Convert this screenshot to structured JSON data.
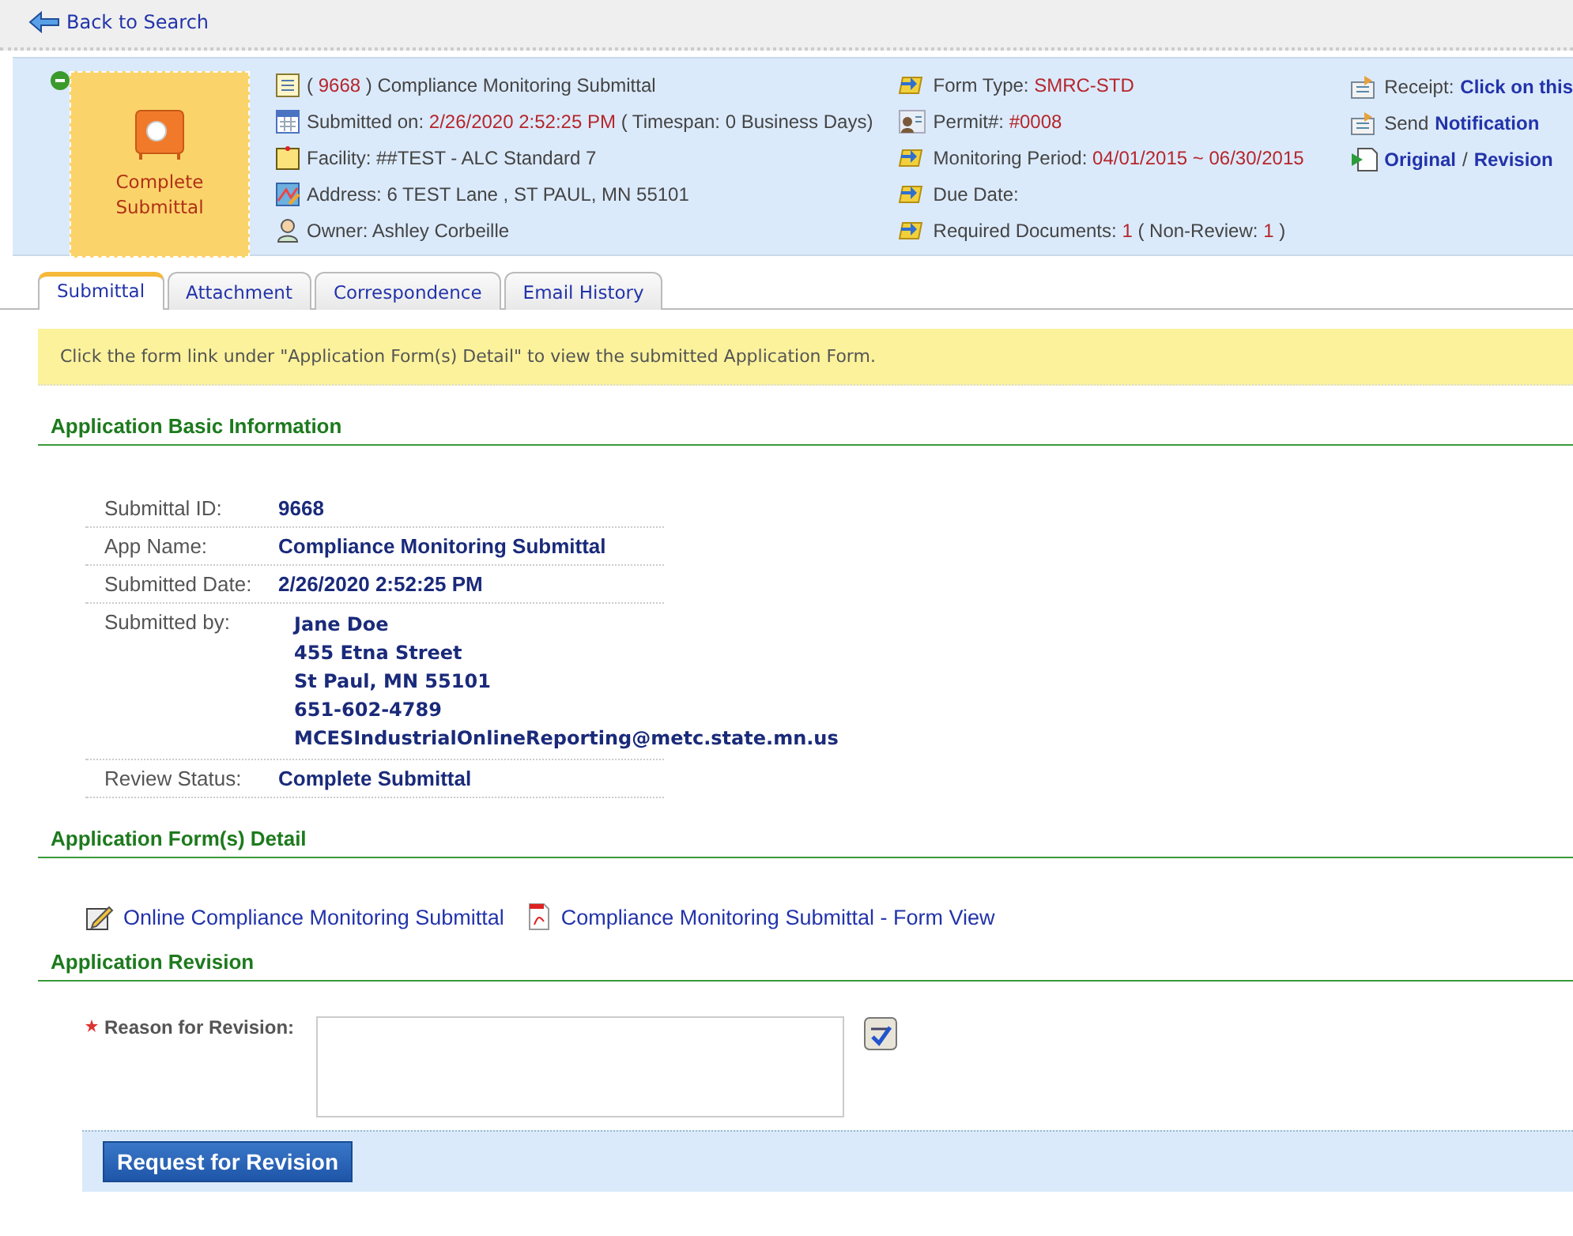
{
  "back_link": "Back to Search",
  "status_tile": {
    "label": "Complete Submittal",
    "expanded": true
  },
  "info_left": [
    {
      "parts": [
        {
          "kind": "plain",
          "text": "( "
        },
        {
          "kind": "value",
          "text": "9668"
        },
        {
          "kind": "plain",
          "text": " )  Compliance Monitoring Submittal"
        }
      ]
    },
    {
      "parts": [
        {
          "kind": "plain",
          "text": "Submitted on: "
        },
        {
          "kind": "value",
          "text": "2/26/2020 2:52:25 PM"
        },
        {
          "kind": "plain",
          "text": " ( Timespan: 0 Business Days)"
        }
      ]
    },
    {
      "parts": [
        {
          "kind": "plain",
          "text": "Facility: ##TEST - ALC Standard 7"
        }
      ]
    },
    {
      "parts": [
        {
          "kind": "plain",
          "text": "Address: 6 TEST Lane , ST PAUL, MN 55101"
        }
      ]
    },
    {
      "parts": [
        {
          "kind": "plain",
          "text": "Owner: Ashley Corbeille"
        }
      ]
    }
  ],
  "info_mid": [
    {
      "parts": [
        {
          "kind": "plain",
          "text": "Form Type: "
        },
        {
          "kind": "value",
          "text": "SMRC-STD"
        }
      ]
    },
    {
      "parts": [
        {
          "kind": "plain",
          "text": "Permit#: "
        },
        {
          "kind": "value",
          "text": "#0008"
        }
      ]
    },
    {
      "parts": [
        {
          "kind": "plain",
          "text": "Monitoring Period: "
        },
        {
          "kind": "value",
          "text": "04/01/2015 ~ 06/30/2015"
        }
      ]
    },
    {
      "parts": [
        {
          "kind": "plain",
          "text": "Due Date:"
        }
      ]
    },
    {
      "parts": [
        {
          "kind": "plain",
          "text": "Required Documents: "
        },
        {
          "kind": "value",
          "text": "1"
        },
        {
          "kind": "plain",
          "text": " ( Non-Review: "
        },
        {
          "kind": "value",
          "text": "1"
        },
        {
          "kind": "plain",
          "text": " )"
        }
      ]
    }
  ],
  "info_right": [
    {
      "parts": [
        {
          "kind": "plain",
          "text": "Receipt: "
        },
        {
          "kind": "link",
          "text": "Click on this"
        }
      ]
    },
    {
      "parts": [
        {
          "kind": "plain",
          "text": "Send "
        },
        {
          "kind": "link",
          "text": "Notification"
        }
      ]
    },
    {
      "parts": [
        {
          "kind": "link",
          "text": "Original"
        },
        {
          "kind": "plain",
          "text": "/"
        },
        {
          "kind": "link",
          "text": "Revision"
        }
      ]
    }
  ],
  "tabs": [
    {
      "label": "Submittal",
      "selected": true
    },
    {
      "label": "Attachment",
      "selected": false
    },
    {
      "label": "Correspondence",
      "selected": false
    },
    {
      "label": "Email History",
      "selected": false
    }
  ],
  "notice": "Click the form link under \"Application Form(s) Detail\" to view the submitted Application Form.",
  "basic_info": {
    "title": "Application Basic Information",
    "rows": [
      {
        "label": "Submittal ID:",
        "kind": "single",
        "value": "9668"
      },
      {
        "label": "App Name:",
        "kind": "single",
        "value": "Compliance Monitoring Submittal"
      },
      {
        "label": "Submitted Date:",
        "kind": "single",
        "value": "2/26/2020 2:52:25 PM"
      },
      {
        "label": "Submitted by:",
        "kind": "multi",
        "lines": [
          "Jane Doe",
          "455 Etna Street",
          "St Paul, MN 55101",
          "651-602-4789",
          "MCESIndustrialOnlineReporting@metc.state.mn.us"
        ]
      },
      {
        "label": "Review Status:",
        "kind": "single",
        "value": "Complete Submittal"
      }
    ]
  },
  "forms_detail": {
    "title": "Application Form(s) Detail",
    "links": [
      {
        "kind": "edit",
        "text": "Online Compliance Monitoring Submittal"
      },
      {
        "kind": "pdf",
        "text": "Compliance Monitoring Submittal - Form View"
      }
    ]
  },
  "revision": {
    "title": "Application Revision",
    "field_label": "Reason for Revision:",
    "required": true,
    "button": "Request for Revision"
  }
}
